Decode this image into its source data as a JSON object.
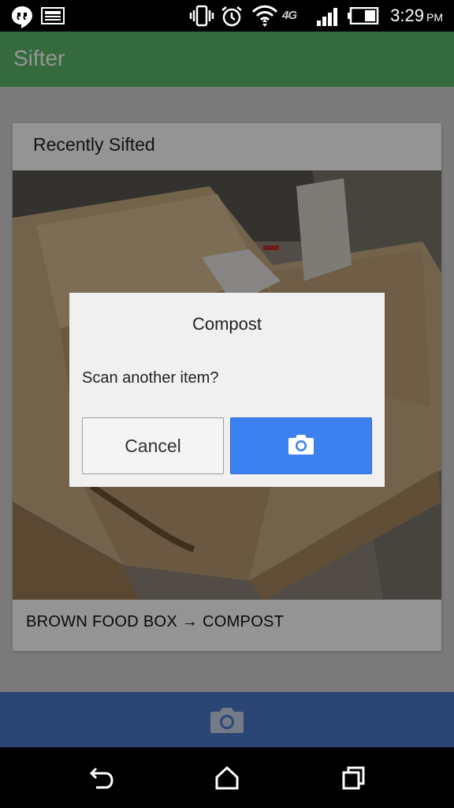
{
  "status_bar": {
    "time": "3:29",
    "ampm": "PM",
    "network": "4G",
    "icons": [
      "hangouts-icon",
      "notification-icon",
      "vibrate-icon",
      "alarm-icon",
      "wifi-icon",
      "signal-icon",
      "battery-icon"
    ]
  },
  "app": {
    "title": "Sifter",
    "colors": {
      "appbar": "#2e9c44",
      "bottombar": "#23549f",
      "accent": "#3d80f0"
    }
  },
  "card": {
    "title": "Recently Sifted",
    "caption": "BROWN FOOD BOX → COMPOST",
    "image": "brown-food-box-photo"
  },
  "dialog": {
    "title": "Compost",
    "message": "Scan another item?",
    "cancel_label": "Cancel",
    "confirm_icon": "camera-icon"
  },
  "bottom_bar": {
    "icon": "camera-icon"
  },
  "nav_bar": {
    "icons": [
      "back-icon",
      "home-icon",
      "recents-icon"
    ]
  }
}
